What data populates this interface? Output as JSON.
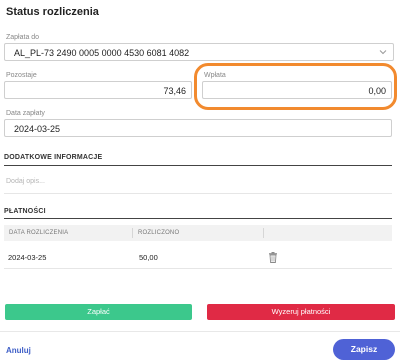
{
  "title": "Status rozliczenia",
  "payment_to": {
    "label": "Zapłata do",
    "value": "AL_PL-73 2490 0005 0000 4530 6081 4082"
  },
  "remaining": {
    "label": "Pozostaje",
    "value": "73,46"
  },
  "payment": {
    "label": "Wpłata",
    "value": "0,00"
  },
  "payment_date": {
    "label": "Data zapłaty",
    "value": "2024-03-25"
  },
  "additional_info": {
    "heading": "DODATKOWE INFORMACJE",
    "placeholder": "Dodaj opis..."
  },
  "payments": {
    "heading": "PŁATNOŚCI",
    "columns": [
      "DATA ROZLICZENIA",
      "ROZLICZONO"
    ],
    "rows": [
      {
        "date": "2024-03-25",
        "amount": "50,00"
      }
    ]
  },
  "buttons": {
    "pay": "Zapłać",
    "reset": "Wyzeruj płatności",
    "cancel": "Anuluj",
    "save": "Zapisz"
  },
  "colors": {
    "green": "#3cc88c",
    "red": "#e02a45",
    "primary": "#4f62d6",
    "highlight": "#f28a2e"
  },
  "icons": {
    "dropdown": "chevron-down-icon",
    "delete": "trash-icon"
  }
}
